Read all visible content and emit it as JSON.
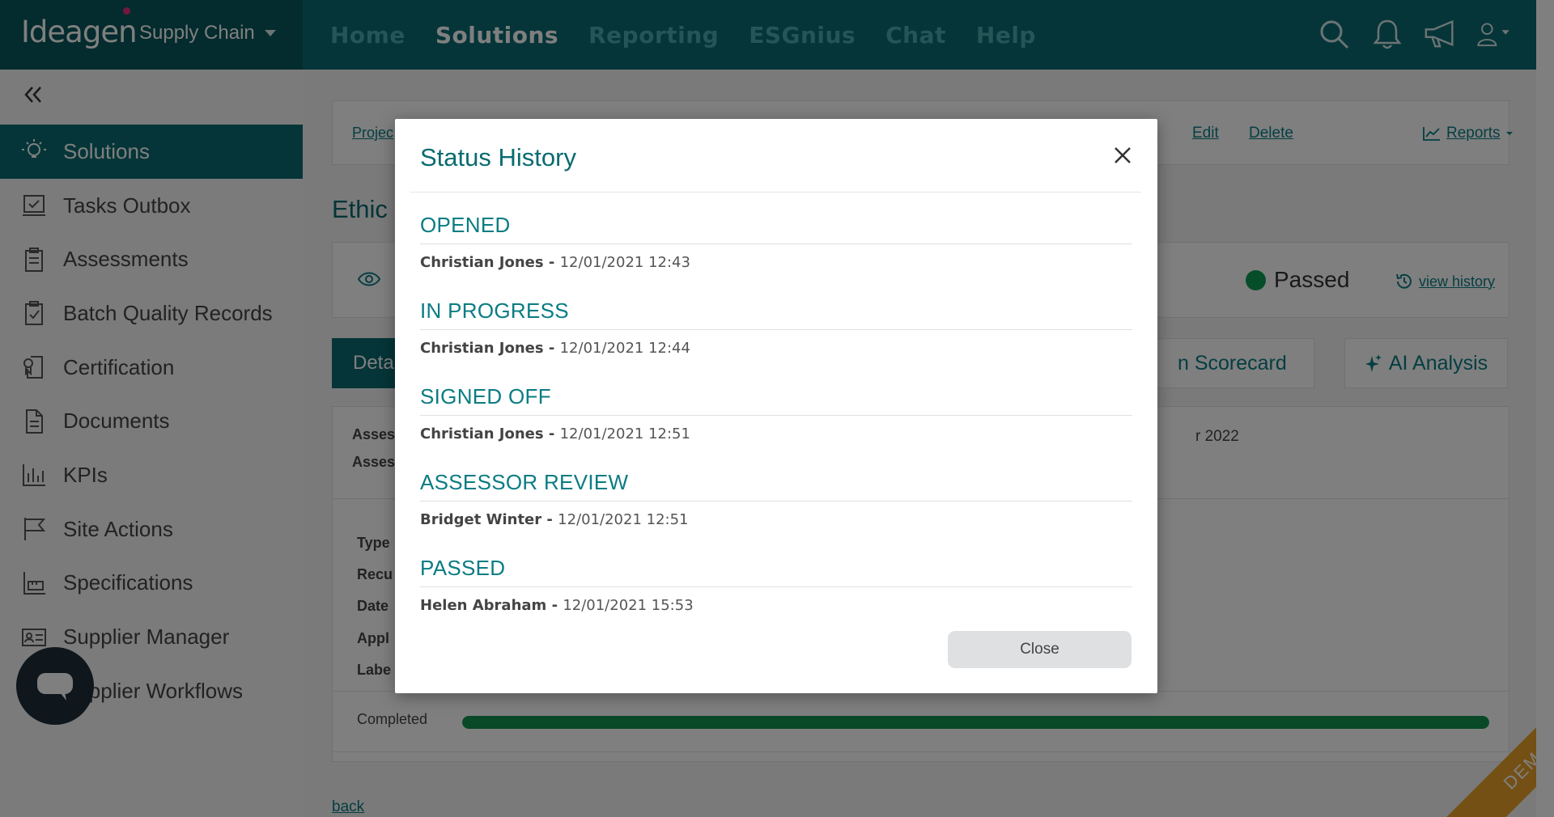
{
  "brand": {
    "logo_text": "Ideagen",
    "product": "Supply Chain"
  },
  "nav": [
    {
      "label": "Home",
      "active": false
    },
    {
      "label": "Solutions",
      "active": true
    },
    {
      "label": "Reporting",
      "active": false
    },
    {
      "label": "ESGnius",
      "active": false
    },
    {
      "label": "Chat",
      "active": false
    },
    {
      "label": "Help",
      "active": false
    }
  ],
  "top_icons": [
    "search-icon",
    "bell-icon",
    "megaphone-icon",
    "user-icon"
  ],
  "sidebar": {
    "items": [
      {
        "label": "Solutions",
        "icon": "lightbulb-icon",
        "active": true
      },
      {
        "label": "Tasks Outbox",
        "icon": "tasks-icon"
      },
      {
        "label": "Assessments",
        "icon": "clipboard-icon"
      },
      {
        "label": "Batch Quality Records",
        "icon": "clipboard-check-icon"
      },
      {
        "label": "Certification",
        "icon": "certificate-icon"
      },
      {
        "label": "Documents",
        "icon": "document-icon"
      },
      {
        "label": "KPIs",
        "icon": "bar-chart-icon"
      },
      {
        "label": "Site Actions",
        "icon": "flag-icon"
      },
      {
        "label": "Specifications",
        "icon": "ruler-icon"
      },
      {
        "label": "Supplier Manager",
        "icon": "id-card-icon"
      },
      {
        "label": "Supplier Workflows",
        "icon": "list-icon"
      }
    ]
  },
  "main": {
    "breadcrumb": "Projec",
    "actions": {
      "edit": "Edit",
      "delete": "Delete",
      "reports": "Reports"
    },
    "title_partial": "Ethic",
    "status": {
      "label": "Passed",
      "view_history": "view history"
    },
    "tabs": {
      "details": "Deta",
      "scorecard": "n Scorecard",
      "ai": "AI Analysis"
    },
    "details": {
      "label1": "Asses",
      "label2": "Asses",
      "date_partial": "r 2022"
    },
    "info_labels": [
      "Type",
      "Recu",
      "Date",
      "Appl",
      "Labe"
    ],
    "completed": {
      "label": "Completed",
      "progress": 1.0
    },
    "back": "back"
  },
  "modal": {
    "title": "Status History",
    "close_label": "Close",
    "entries": [
      {
        "status": "OPENED",
        "user": "Christian Jones",
        "sep": " - ",
        "datetime": "12/01/2021 12:43"
      },
      {
        "status": "IN PROGRESS",
        "user": "Christian Jones",
        "sep": " - ",
        "datetime": "12/01/2021 12:44"
      },
      {
        "status": "SIGNED OFF",
        "user": "Christian Jones",
        "sep": " - ",
        "datetime": "12/01/2021 12:51"
      },
      {
        "status": "ASSESSOR REVIEW",
        "user": "Bridget Winter",
        "sep": " - ",
        "datetime": "12/01/2021 12:51"
      },
      {
        "status": "PASSED",
        "user": "Helen Abraham",
        "sep": " - ",
        "datetime": "12/01/2021 15:53"
      }
    ]
  },
  "ribbon": "DEMO",
  "colors": {
    "brand": "#0a6b70",
    "brand_dark": "#09575b",
    "accent_link": "#0a7c83",
    "success": "#13934f",
    "ribbon": "#e9a12a"
  }
}
